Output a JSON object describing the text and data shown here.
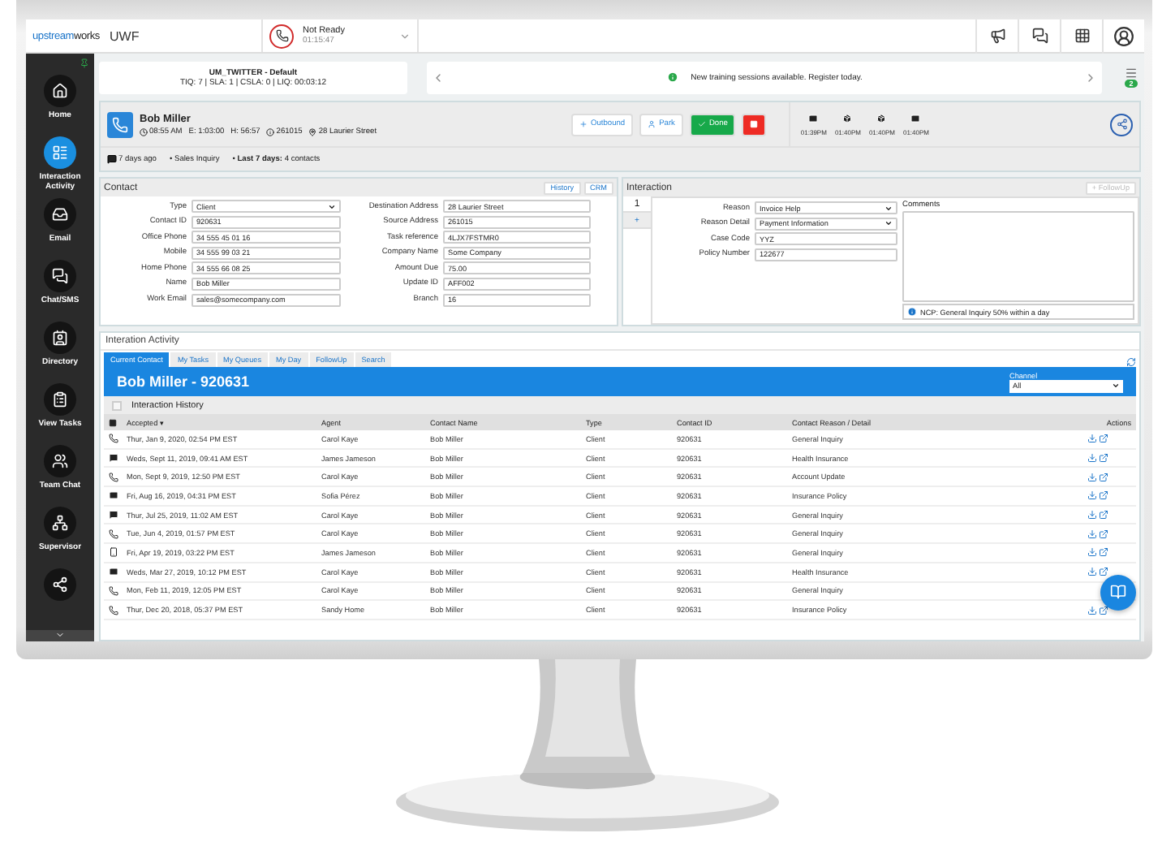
{
  "topbar": {
    "logo": [
      "upstream",
      "works"
    ],
    "app": "UWF",
    "status": "Not Ready",
    "timer": "01:15:47"
  },
  "sidebar": {
    "items": [
      {
        "label": "Home",
        "selected": false
      },
      {
        "label": "Interaction Activity",
        "selected": true
      },
      {
        "label": "Email",
        "selected": false
      },
      {
        "label": "Chat/SMS",
        "selected": false
      },
      {
        "label": "Directory",
        "selected": false
      },
      {
        "label": "View Tasks",
        "selected": false
      },
      {
        "label": "Team Chat",
        "selected": false
      },
      {
        "label": "Supervisor",
        "selected": false
      },
      {
        "selected": false
      }
    ]
  },
  "queue": {
    "name": "UM_TWITTER - Default",
    "stats": "TIQ: 7 | SLA: 1 | CSLA: 0 | LIQ: 00:03:12"
  },
  "banner": {
    "message": "New training sessions available. Register today.",
    "badge": "2"
  },
  "contact_header": {
    "name": "Bob Miller",
    "time": "08:55 AM",
    "elapsed": "E: 1:03:00",
    "hold": "H: 56:57",
    "source": "261015",
    "address": "28 Laurier Street",
    "buttons": [
      {
        "label": "Outbound",
        "kind": "outbound"
      },
      {
        "label": "Park",
        "kind": "park"
      },
      {
        "label": "Done",
        "kind": "done"
      },
      {
        "kind": "end"
      }
    ],
    "recent": [
      {
        "kind": "email",
        "time": "01:39PM"
      },
      {
        "kind": "box",
        "time": "01:40PM"
      },
      {
        "kind": "box",
        "time": "01:40PM"
      },
      {
        "kind": "email",
        "time": "01:40PM"
      }
    ],
    "last_contact": "7 days ago",
    "reason": "• Sales Inquiry",
    "summary": "• **Last 7 days:** 4 contacts"
  },
  "contact": {
    "title": "Contact",
    "buttons": [
      "History",
      "CRM"
    ],
    "left": [
      {
        "label": "Type",
        "value": "Client",
        "kind": "select"
      },
      {
        "label": "Contact ID",
        "value": "920631",
        "kind": "text"
      },
      {
        "label": "Office Phone",
        "value": "34 555 45 01 16",
        "kind": "text"
      },
      {
        "label": "Mobile",
        "value": "34 555 99 03 21",
        "kind": "text"
      },
      {
        "label": "Home Phone",
        "value": "34 555 66 08 25",
        "kind": "text"
      },
      {
        "label": "Name",
        "value": "Bob Miller",
        "kind": "text"
      },
      {
        "label": "Work Email",
        "value": "sales@somecompany.com",
        "kind": "text"
      }
    ],
    "right": [
      {
        "label": "Destination Address",
        "value": "28 Laurier Street"
      },
      {
        "label": "Source Address",
        "value": "261015"
      },
      {
        "label": "Task reference",
        "value": "4LJX7FSTMR0"
      },
      {
        "label": "Company Name",
        "value": "Some Company"
      },
      {
        "label": "Amount Due",
        "value": "75.00"
      },
      {
        "label": "Update ID",
        "value": "AFF002"
      },
      {
        "label": "Branch",
        "value": "16"
      }
    ]
  },
  "interaction": {
    "title": "Interaction",
    "followup": {
      "label": "+ FollowUp",
      "disabled": true
    },
    "tabs": [
      {
        "label": "1",
        "selected": true
      },
      {
        "label": "+",
        "selected": false
      }
    ],
    "fields": [
      {
        "label": "Reason",
        "value": "Invoice Help",
        "kind": "select"
      },
      {
        "label": "Reason Detail",
        "value": "Payment Information",
        "kind": "select"
      },
      {
        "label": "Case Code",
        "value": "YYZ",
        "kind": "text"
      },
      {
        "label": "Policy Number",
        "value": "122677",
        "kind": "text"
      }
    ],
    "comments_label": "Comments",
    "notice": "NCP: General Inquiry 50% within a day"
  },
  "activity": {
    "title": "Interation Activity",
    "tabs": [
      {
        "label": "Current Contact",
        "selected": true
      },
      {
        "label": "My Tasks",
        "selected": false
      },
      {
        "label": "My Queues",
        "selected": false
      },
      {
        "label": "My Day",
        "selected": false
      },
      {
        "label": "FollowUp",
        "selected": false
      },
      {
        "label": "Search",
        "selected": false
      }
    ],
    "heading": "Bob Miller - 920631",
    "channel_label": "Channel",
    "channel_value": "All",
    "history_title": "Interaction History",
    "history_checked": false,
    "columns": [
      "Accepted ▾",
      "Agent",
      "Contact Name",
      "Type",
      "Contact ID",
      "Contact Reason / Detail",
      "Actions"
    ],
    "rows": [
      {
        "kind": "phone",
        "accepted": "Thur, Jan 9, 2020, 02:54 PM EST",
        "agent": "Carol Kaye",
        "contact": "Bob Miller",
        "type": "Client",
        "id": "920631",
        "reason": "General Inquiry"
      },
      {
        "kind": "chat",
        "accepted": "Weds, Sept 11, 2019, 09:41 AM EST",
        "agent": "James Jameson",
        "contact": "Bob Miller",
        "type": "Client",
        "id": "920631",
        "reason": "Health Insurance"
      },
      {
        "kind": "phone",
        "accepted": "Mon, Sept 9, 2019, 12:50 PM EST",
        "agent": "Carol Kaye",
        "contact": "Bob Miller",
        "type": "Client",
        "id": "920631",
        "reason": "Account Update"
      },
      {
        "kind": "email",
        "accepted": "Fri, Aug 16, 2019, 04:31 PM EST",
        "agent": "Sofia Pérez",
        "contact": "Bob Miller",
        "type": "Client",
        "id": "920631",
        "reason": "Insurance Policy"
      },
      {
        "kind": "chat",
        "accepted": "Thur, Jul 25, 2019, 11:02 AM EST",
        "agent": "Carol Kaye",
        "contact": "Bob Miller",
        "type": "Client",
        "id": "920631",
        "reason": "General Inquiry"
      },
      {
        "kind": "phone",
        "accepted": "Tue, Jun 4, 2019, 01:57 PM EST",
        "agent": "Carol Kaye",
        "contact": "Bob Miller",
        "type": "Client",
        "id": "920631",
        "reason": "General Inquiry"
      },
      {
        "kind": "mobile",
        "accepted": "Fri, Apr 19, 2019, 03:22 PM EST",
        "agent": "James Jameson",
        "contact": "Bob Miller",
        "type": "Client",
        "id": "920631",
        "reason": "General Inquiry"
      },
      {
        "kind": "email",
        "accepted": "Weds, Mar 27, 2019, 10:12 PM EST",
        "agent": "Carol Kaye",
        "contact": "Bob Miller",
        "type": "Client",
        "id": "920631",
        "reason": "Health Insurance"
      },
      {
        "kind": "phone",
        "accepted": "Mon, Feb 11, 2019, 12:05 PM EST",
        "agent": "Carol Kaye",
        "contact": "Bob Miller",
        "type": "Client",
        "id": "920631",
        "reason": "General Inquiry"
      },
      {
        "kind": "phone",
        "accepted": "Thur, Dec 20, 2018, 05:37 PM EST",
        "agent": "Sandy Home",
        "contact": "Bob Miller",
        "type": "Client",
        "id": "920631",
        "reason": "Insurance Policy"
      }
    ]
  }
}
